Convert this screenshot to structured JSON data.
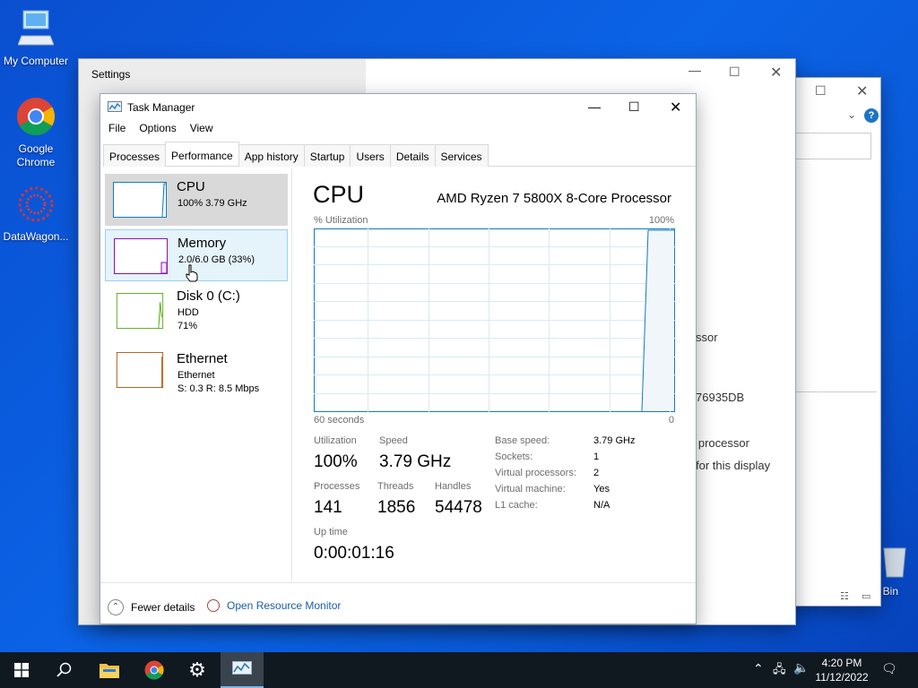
{
  "desktop": {
    "icons": [
      {
        "label": "My Computer"
      },
      {
        "label": "Google Chrome"
      },
      {
        "label": "DataWagon..."
      },
      {
        "label": "e Bin"
      }
    ]
  },
  "settings_window": {
    "title": "Settings",
    "behind_text": [
      "ssor",
      "76935DB",
      "d processor",
      "for this display"
    ]
  },
  "task_manager": {
    "title": "Task Manager",
    "menu": [
      "File",
      "Options",
      "View"
    ],
    "tabs": [
      "Processes",
      "Performance",
      "App history",
      "Startup",
      "Users",
      "Details",
      "Services"
    ],
    "active_tab": "Performance",
    "resources": [
      {
        "name": "CPU",
        "line1": "100% 3.79 GHz",
        "line2": "",
        "color": "#117dbb"
      },
      {
        "name": "Memory",
        "line1": "2.0/6.0 GB (33%)",
        "line2": "",
        "color": "#8b12ae"
      },
      {
        "name": "Disk 0 (C:)",
        "line1": "HDD",
        "line2": "71%",
        "color": "#4da60c"
      },
      {
        "name": "Ethernet",
        "line1": "Ethernet",
        "line2": "S: 0.3  R: 8.5 Mbps",
        "color": "#a74f01"
      }
    ],
    "cpu_panel": {
      "title": "CPU",
      "processor": "AMD Ryzen 7 5800X 8-Core Processor",
      "graph_label": "% Utilization",
      "graph_max": "100%",
      "graph_time": "60 seconds",
      "graph_min": "0",
      "stats": {
        "utilization_label": "Utilization",
        "utilization": "100%",
        "speed_label": "Speed",
        "speed": "3.79 GHz",
        "processes_label": "Processes",
        "processes": "141",
        "threads_label": "Threads",
        "threads": "1856",
        "handles_label": "Handles",
        "handles": "54478",
        "uptime_label": "Up time",
        "uptime": "0:00:01:16"
      },
      "details": [
        {
          "k": "Base speed:",
          "v": "3.79 GHz"
        },
        {
          "k": "Sockets:",
          "v": "1"
        },
        {
          "k": "Virtual processors:",
          "v": "2"
        },
        {
          "k": "Virtual machine:",
          "v": "Yes"
        },
        {
          "k": "L1 cache:",
          "v": "N/A"
        }
      ]
    },
    "footer": {
      "fewer_details": "Fewer details",
      "resource_monitor": "Open Resource Monitor"
    }
  },
  "taskbar": {
    "time": "4:20 PM",
    "date": "11/12/2022"
  }
}
